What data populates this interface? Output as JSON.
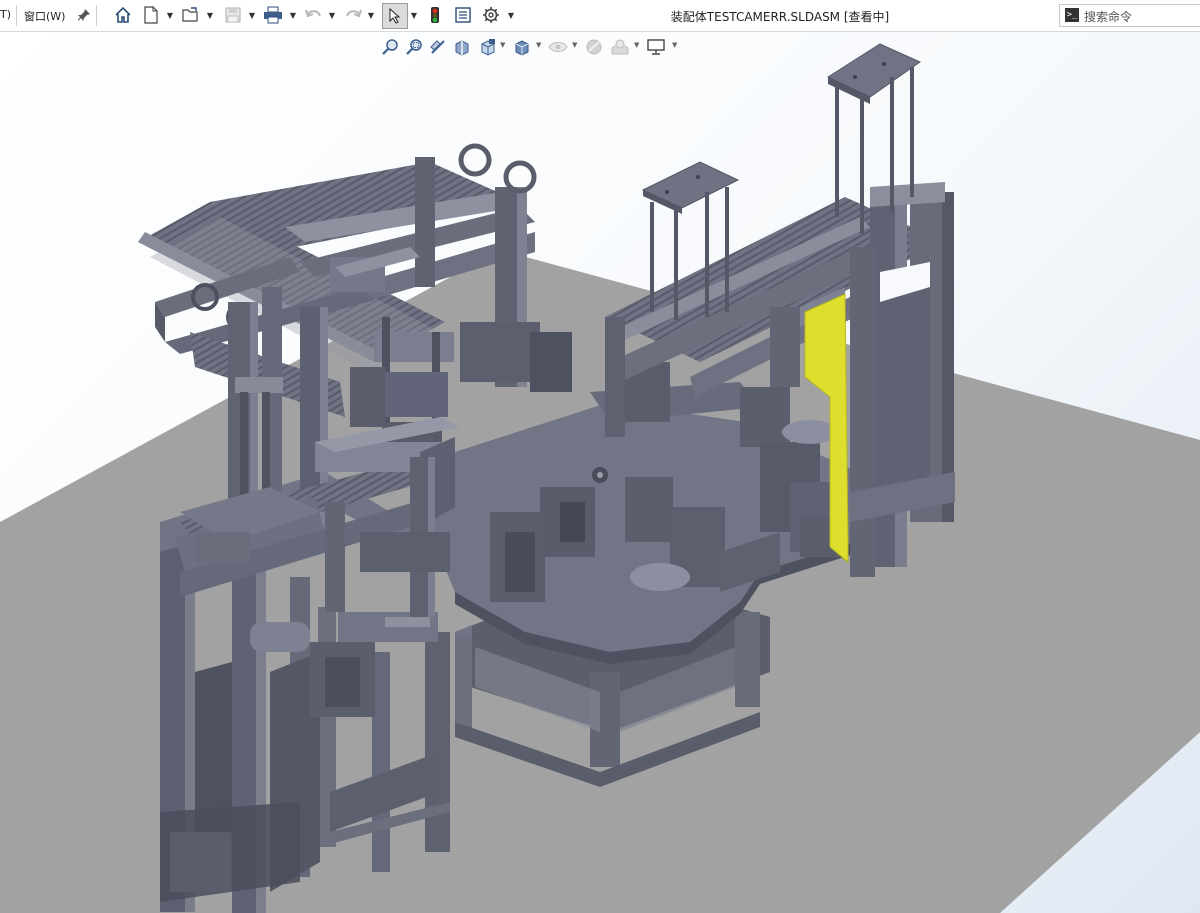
{
  "menu": {
    "left_fragment": "T)",
    "window_menu": "窗口(W)"
  },
  "toolbar": {
    "icons": [
      "pin-icon",
      "home-icon",
      "new-document-icon",
      "open-folder-icon",
      "save-icon",
      "print-icon",
      "undo-icon",
      "redo-icon",
      "select-cursor-icon",
      "traffic-light-icon",
      "file-properties-icon",
      "options-gear-icon"
    ]
  },
  "document": {
    "title": "装配体TESTCAMERR.SLDASM [查看中]"
  },
  "search": {
    "placeholder": "搜索命令",
    "icon": "command-prompt-icon"
  },
  "heads_up_toolbar": {
    "icons": [
      "zoom-to-fit-icon",
      "zoom-to-area-icon",
      "previous-view-icon",
      "section-view-icon",
      "view-orientation-icon",
      "display-style-icon",
      "hide-show-items-icon",
      "edit-appearance-icon",
      "apply-scene-icon",
      "view-settings-icon"
    ]
  },
  "colors": {
    "machine_frame": "#6e7282",
    "machine_dark": "#4b4e5c",
    "machine_light": "#8d91a1",
    "floor": "#a1a1a1",
    "highlight_part": "#dede2e"
  }
}
